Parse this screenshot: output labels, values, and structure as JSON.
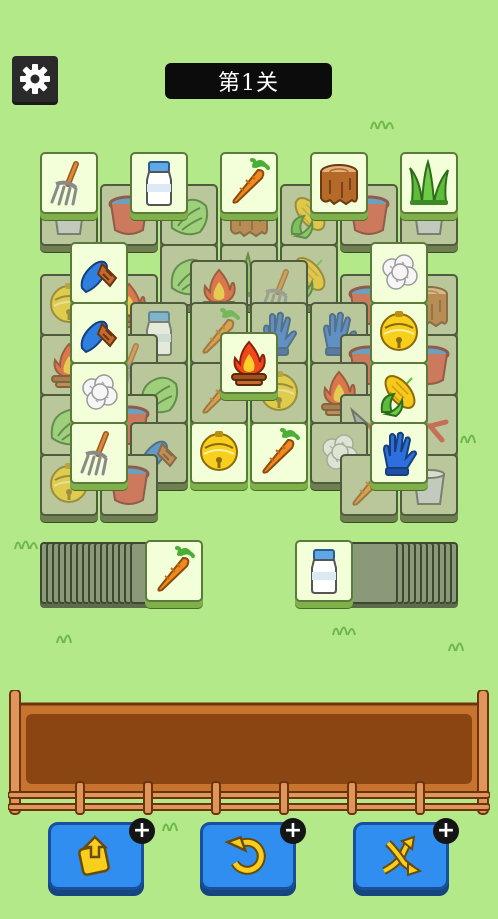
{
  "header": {
    "level_label": "第1关"
  },
  "icons": {
    "settings": "gear-icon",
    "tool_move_out": "move-out-icon",
    "tool_undo": "undo-icon",
    "tool_shuffle": "shuffle-icon",
    "tool_plus": "+"
  },
  "board": {
    "top_row": [
      "pitchfork",
      "milk-bottle",
      "carrot",
      "tree-stump",
      "grass"
    ],
    "left_column": [
      "brush",
      "brush",
      "cotton",
      "pitchfork"
    ],
    "right_column": [
      "cotton",
      "bell",
      "corn",
      "glove"
    ],
    "center": [
      "campfire",
      "bell",
      "carrot"
    ]
  },
  "stacks": {
    "left_top": "carrot",
    "right_top": "milk-bottle"
  },
  "colors": {
    "background": "#b4e98a",
    "tile_face": "#f3ffd8",
    "button": "#2f8ef0",
    "fence": "#c8742f"
  }
}
